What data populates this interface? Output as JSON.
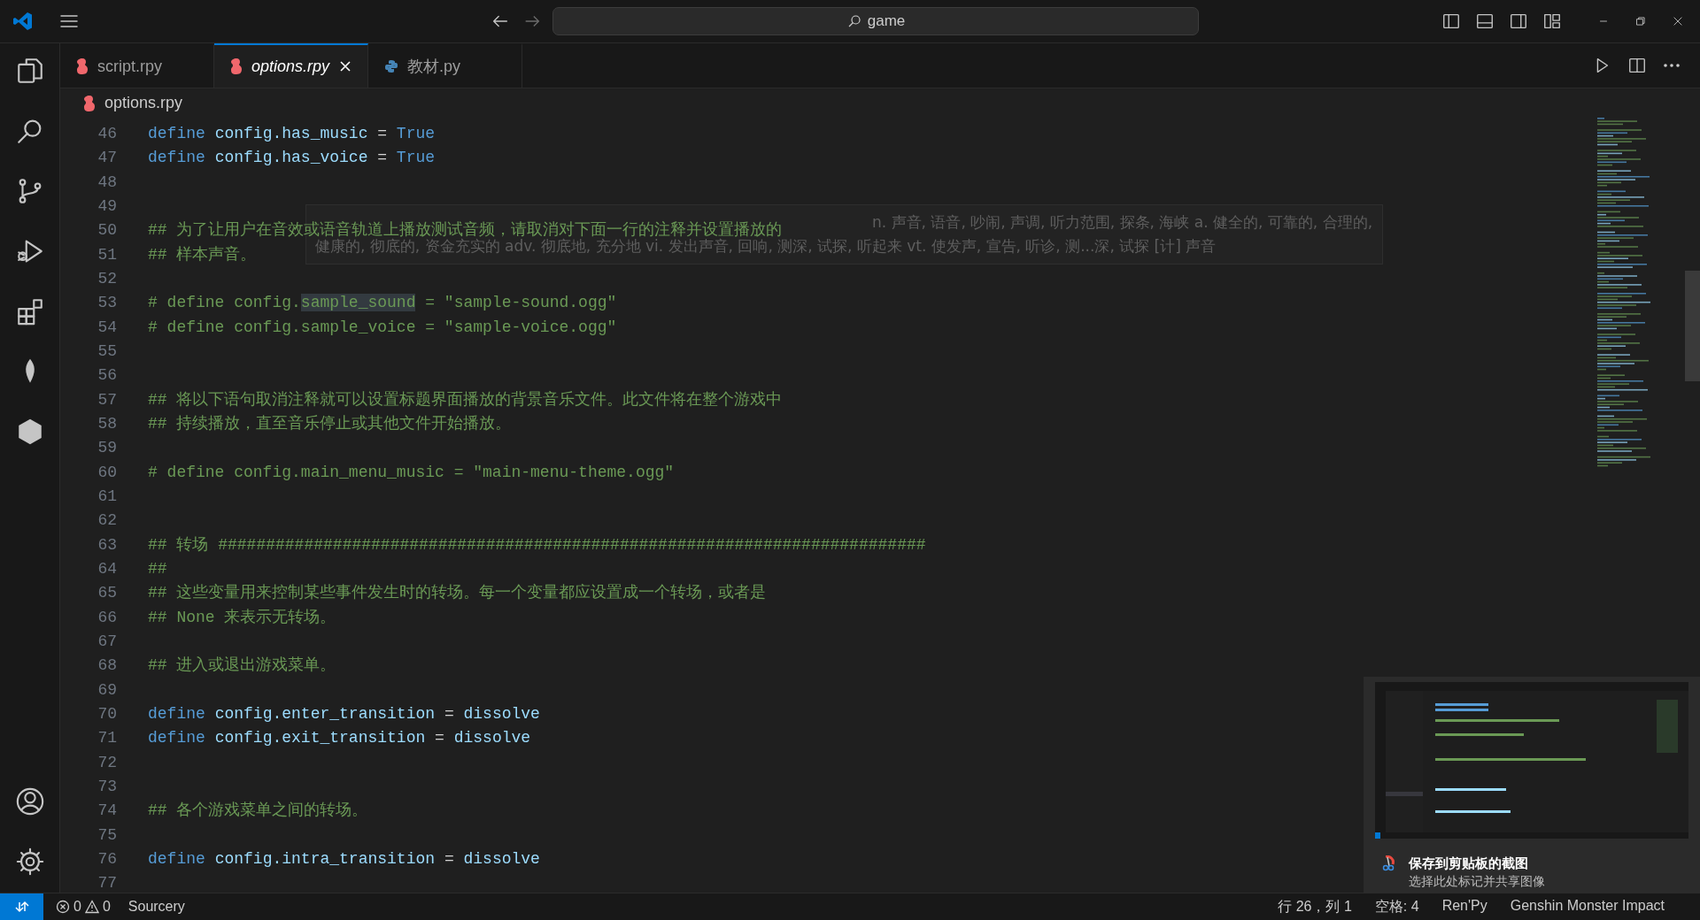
{
  "title_bar": {
    "search": "game"
  },
  "tabs": [
    {
      "label": "script.rpy",
      "kind": "renpy",
      "selected": false
    },
    {
      "label": "options.rpy",
      "kind": "renpy",
      "selected": true
    },
    {
      "label": "教材.py",
      "kind": "python",
      "selected": false
    }
  ],
  "breadcrumb": {
    "label": "options.rpy",
    "kind": "renpy"
  },
  "editor": {
    "lines": [
      {
        "number": "46",
        "segments": [
          {
            "kind": "keyword",
            "text": "define "
          },
          {
            "kind": "variable",
            "text": "config.has_music"
          },
          {
            "kind": "plain",
            "text": " = "
          },
          {
            "kind": "keyword",
            "text": "True"
          }
        ]
      },
      {
        "number": "47",
        "segments": [
          {
            "kind": "keyword",
            "text": "define "
          },
          {
            "kind": "variable",
            "text": "config.has_voice"
          },
          {
            "kind": "plain",
            "text": " = "
          },
          {
            "kind": "keyword",
            "text": "True"
          }
        ]
      },
      {
        "number": "48"
      },
      {
        "number": "49"
      },
      {
        "number": "50",
        "segments": [
          {
            "kind": "comment",
            "text": "## 为了让用户在音效或语音轨道上播放测试音频，请取消对下面一行的注释并设置播放的"
          }
        ]
      },
      {
        "number": "51",
        "segments": [
          {
            "kind": "comment",
            "text": "## 样本声音。"
          }
        ]
      },
      {
        "number": "52"
      },
      {
        "number": "53",
        "segments": [
          {
            "kind": "comment",
            "text": "# define config."
          },
          {
            "kind": "highlight",
            "text": "sample_sound"
          },
          {
            "kind": "comment",
            "text": " = \"sample-sound.ogg\""
          }
        ]
      },
      {
        "number": "54",
        "segments": [
          {
            "kind": "comment",
            "text": "# define config.sample_voice = \"sample-voice.ogg\""
          }
        ]
      },
      {
        "number": "55"
      },
      {
        "number": "56"
      },
      {
        "number": "57",
        "segments": [
          {
            "kind": "comment",
            "text": "## 将以下语句取消注释就可以设置标题界面播放的背景音乐文件。此文件将在整个游戏中"
          }
        ]
      },
      {
        "number": "58",
        "segments": [
          {
            "kind": "comment",
            "text": "## 持续播放，直至音乐停止或其他文件开始播放。"
          }
        ]
      },
      {
        "number": "59"
      },
      {
        "number": "60",
        "segments": [
          {
            "kind": "comment",
            "text": "# define config.main_menu_music = \"main-menu-theme.ogg\""
          }
        ]
      },
      {
        "number": "61"
      },
      {
        "number": "62"
      },
      {
        "number": "63",
        "segments": [
          {
            "kind": "comment",
            "text": "## 转场 ##########################################################################"
          }
        ]
      },
      {
        "number": "64",
        "segments": [
          {
            "kind": "comment",
            "text": "##"
          }
        ]
      },
      {
        "number": "65",
        "segments": [
          {
            "kind": "comment",
            "text": "## 这些变量用来控制某些事件发生时的转场。每一个变量都应设置成一个转场，或者是"
          }
        ]
      },
      {
        "number": "66",
        "segments": [
          {
            "kind": "comment",
            "text": "## None 来表示无转场。"
          }
        ]
      },
      {
        "number": "67"
      },
      {
        "number": "68",
        "segments": [
          {
            "kind": "comment",
            "text": "## 进入或退出游戏菜单。"
          }
        ]
      },
      {
        "number": "69"
      },
      {
        "number": "70",
        "segments": [
          {
            "kind": "keyword",
            "text": "define "
          },
          {
            "kind": "variable",
            "text": "config.enter_transition"
          },
          {
            "kind": "plain",
            "text": " = "
          },
          {
            "kind": "variable",
            "text": "dissolve"
          }
        ]
      },
      {
        "number": "71",
        "segments": [
          {
            "kind": "keyword",
            "text": "define "
          },
          {
            "kind": "variable",
            "text": "config.exit_transition"
          },
          {
            "kind": "plain",
            "text": " = "
          },
          {
            "kind": "variable",
            "text": "dissolve"
          }
        ]
      },
      {
        "number": "72"
      },
      {
        "number": "73"
      },
      {
        "number": "74",
        "segments": [
          {
            "kind": "comment",
            "text": "## 各个游戏菜单之间的转场。"
          }
        ]
      },
      {
        "number": "75"
      },
      {
        "number": "76",
        "segments": [
          {
            "kind": "keyword",
            "text": "define "
          },
          {
            "kind": "variable",
            "text": "config.intra_transition"
          },
          {
            "kind": "plain",
            "text": " = "
          },
          {
            "kind": "variable",
            "text": "dissolve"
          }
        ]
      },
      {
        "number": "77"
      }
    ]
  },
  "tooltip": "n. 声音, 语音, 吵闹, 声调, 听力范围, 探条, 海峡 a. 健全的, 可靠的, 合理的, 健康的, 彻底的, 资金充实的 adv. 彻底地, 充分地 vi. 发出声音, 回响, 测深, 试探, 听起来 vt. 使发声, 宣告, 听诊, 测...深, 试探 [计] 声音",
  "notification": {
    "title": "保存到剪贴板的截图",
    "message": "选择此处标记并共享图像"
  },
  "status_bar": {
    "errors": "0",
    "warnings": "0",
    "left": [
      "Sourcery"
    ],
    "right": [
      "行 26，列 1",
      "空格: 4",
      "Ren'Py",
      "Genshin Monster Impact"
    ]
  }
}
